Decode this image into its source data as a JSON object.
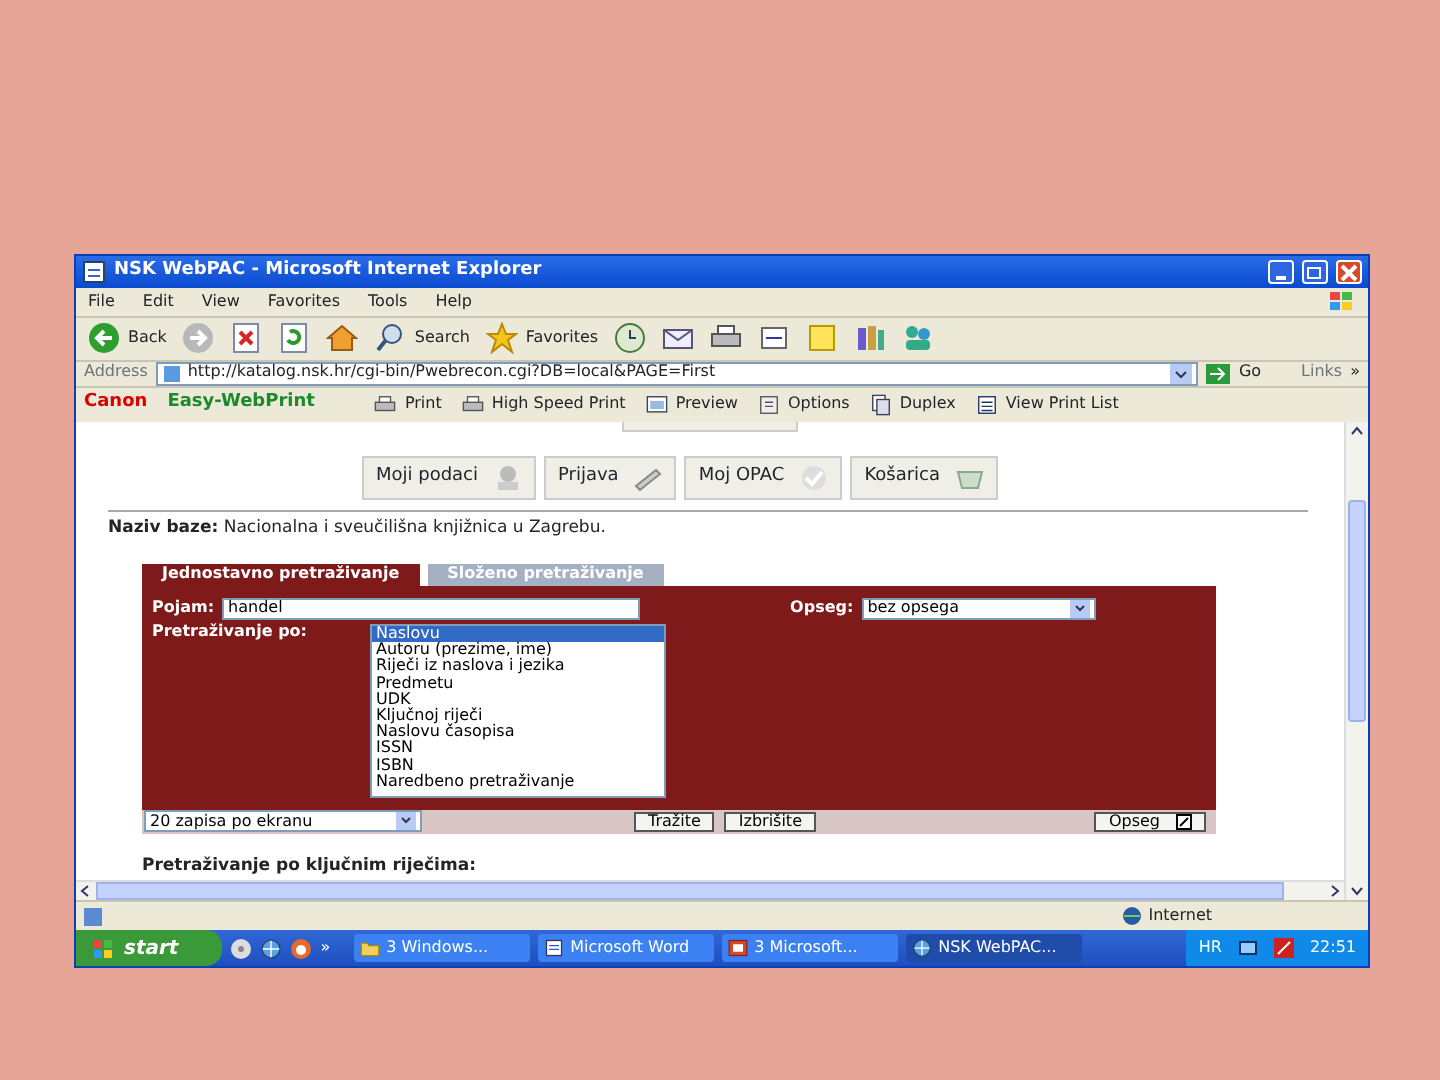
{
  "window": {
    "title": "NSK WebPAC - Microsoft Internet Explorer"
  },
  "menu": [
    "File",
    "Edit",
    "View",
    "Favorites",
    "Tools",
    "Help"
  ],
  "toolbar": [
    {
      "kind": "back",
      "label": "Back"
    },
    {
      "kind": "forward"
    },
    {
      "kind": "stop"
    },
    {
      "kind": "refresh"
    },
    {
      "kind": "home"
    },
    {
      "kind": "search",
      "label": "Search"
    },
    {
      "kind": "favorites",
      "label": "Favorites"
    },
    {
      "kind": "history"
    },
    {
      "kind": "mail"
    },
    {
      "kind": "print"
    },
    {
      "kind": "edit"
    },
    {
      "kind": "note"
    },
    {
      "kind": "research"
    },
    {
      "kind": "messenger"
    }
  ],
  "address": {
    "label": "Address",
    "url": "http://katalog.nsk.hr/cgi-bin/Pwebrecon.cgi?DB=local&PAGE=First",
    "go": "Go",
    "links": "Links",
    "more": "»"
  },
  "print_bar": {
    "brand": "Canon",
    "product": "Easy-WebPrint",
    "items": [
      {
        "kind": "print",
        "label": "Print"
      },
      {
        "kind": "fast",
        "label": "High Speed Print"
      },
      {
        "kind": "preview",
        "label": "Preview"
      },
      {
        "kind": "options",
        "label": "Options"
      },
      {
        "kind": "duplex",
        "label": "Duplex"
      },
      {
        "kind": "list",
        "label": "View Print List"
      }
    ]
  },
  "page": {
    "nav": [
      {
        "label": "Moji podaci"
      },
      {
        "label": "Prijava"
      },
      {
        "label": "Moj OPAC"
      },
      {
        "label": "Košarica"
      }
    ],
    "database": "**Naziv baze:** Nacionalna i sveučilišna knjižnica u Zagrebu.",
    "tabs": [
      {
        "label": "Jednostavno pretraživanje",
        "selected": true
      },
      {
        "label": "Složeno pretraživanje",
        "selected": false
      }
    ],
    "term_label": "Pojam:",
    "term_value": "handel",
    "scope_label": "Opseg:",
    "scope_value": "bez opsega",
    "search_by_label": "Pretraživanje po:",
    "options": [
      {
        "label": "Naslovu",
        "selected": true
      },
      {
        "label": "Autoru (prezime, ime)",
        "selected": false
      },
      {
        "label": "Riječi iz naslova i jezika",
        "selected": false
      },
      {
        "label": "Predmetu",
        "selected": false
      },
      {
        "label": "UDK",
        "selected": false
      },
      {
        "label": "Ključnoj riječi",
        "selected": false
      },
      {
        "label": "Naslovu časopisa",
        "selected": false
      },
      {
        "label": "ISSN",
        "selected": false
      },
      {
        "label": "ISBN",
        "selected": false
      },
      {
        "label": "Naredbeno pretraživanje",
        "selected": false
      }
    ],
    "per_page": "20 zapisa po ekranu",
    "buttons": [
      "Tražite",
      "Izbrišite"
    ],
    "scope_button": "Opseg",
    "keyword_heading": "Pretraživanje po ključnim riječima:"
  },
  "status_bar": {
    "zone": "Internet"
  },
  "taskbar": {
    "start": "start",
    "more": "»",
    "tasks": [
      {
        "kind": "folder",
        "label": "3 Windows...",
        "selected": false
      },
      {
        "kind": "word",
        "label": "Microsoft Word",
        "selected": false
      },
      {
        "kind": "ppt",
        "label": "3 Microsoft...",
        "selected": false
      },
      {
        "kind": "ie",
        "label": "NSK WebPAC...",
        "selected": true
      }
    ],
    "language": "HR",
    "clock": "22:51"
  }
}
